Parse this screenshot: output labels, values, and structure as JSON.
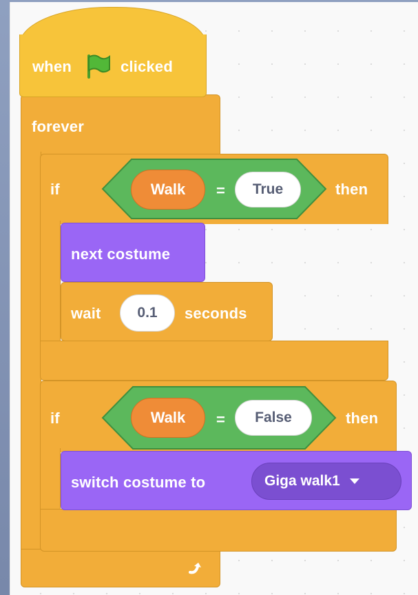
{
  "script": {
    "hat": {
      "when": "when",
      "icon": "green-flag-icon",
      "clicked": "clicked"
    },
    "forever": {
      "label": "forever",
      "icon": "loop-arrow-icon"
    },
    "if1": {
      "if": "if",
      "variable": "Walk",
      "operator": "=",
      "value": "True",
      "then": "then",
      "next_costume": "next costume",
      "wait": "wait",
      "wait_value": "0.1",
      "seconds": "seconds"
    },
    "if2": {
      "if": "if",
      "variable": "Walk",
      "operator": "=",
      "value": "False",
      "then": "then",
      "switch_label": "switch costume to",
      "costume": "Giga walk1",
      "dropdown_icon": "dropdown-caret-icon"
    }
  },
  "colors": {
    "events": "#f7c43a",
    "control": "#f2ad39",
    "looks": "#9a66f5",
    "operators": "#5cb85c",
    "variables": "#ef8c37"
  }
}
